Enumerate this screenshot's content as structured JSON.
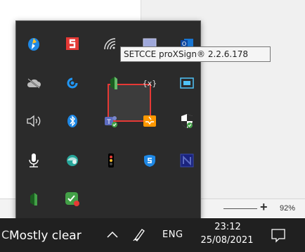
{
  "tooltip": {
    "text": "SETCCE proXSign® 2.2.6.178"
  },
  "zoom": {
    "plus_label": "+",
    "percent": "92%"
  },
  "taskbar": {
    "weather_partial": "C",
    "weather_text": "Mostly clear",
    "language": "ENG",
    "time": "23:12",
    "date": "25/08/2021"
  },
  "tray_icons": [
    "colorful-app-icon",
    "s-app-icon",
    "wifi-icon",
    "window-icon",
    "outlook-icon",
    "cloud-off-icon",
    "sync-icon",
    "proxsign-icon",
    "ime-icon",
    "remote-desktop-icon",
    "speaker-icon",
    "bluetooth-icon",
    "teams-icon",
    "inbox-icon",
    "security-shield-icon",
    "microphone-icon",
    "globe-app-icon",
    "traffic-light-icon",
    "s-shield-icon",
    "n-app-icon",
    "green-app-icon",
    "green-check-app-icon"
  ]
}
